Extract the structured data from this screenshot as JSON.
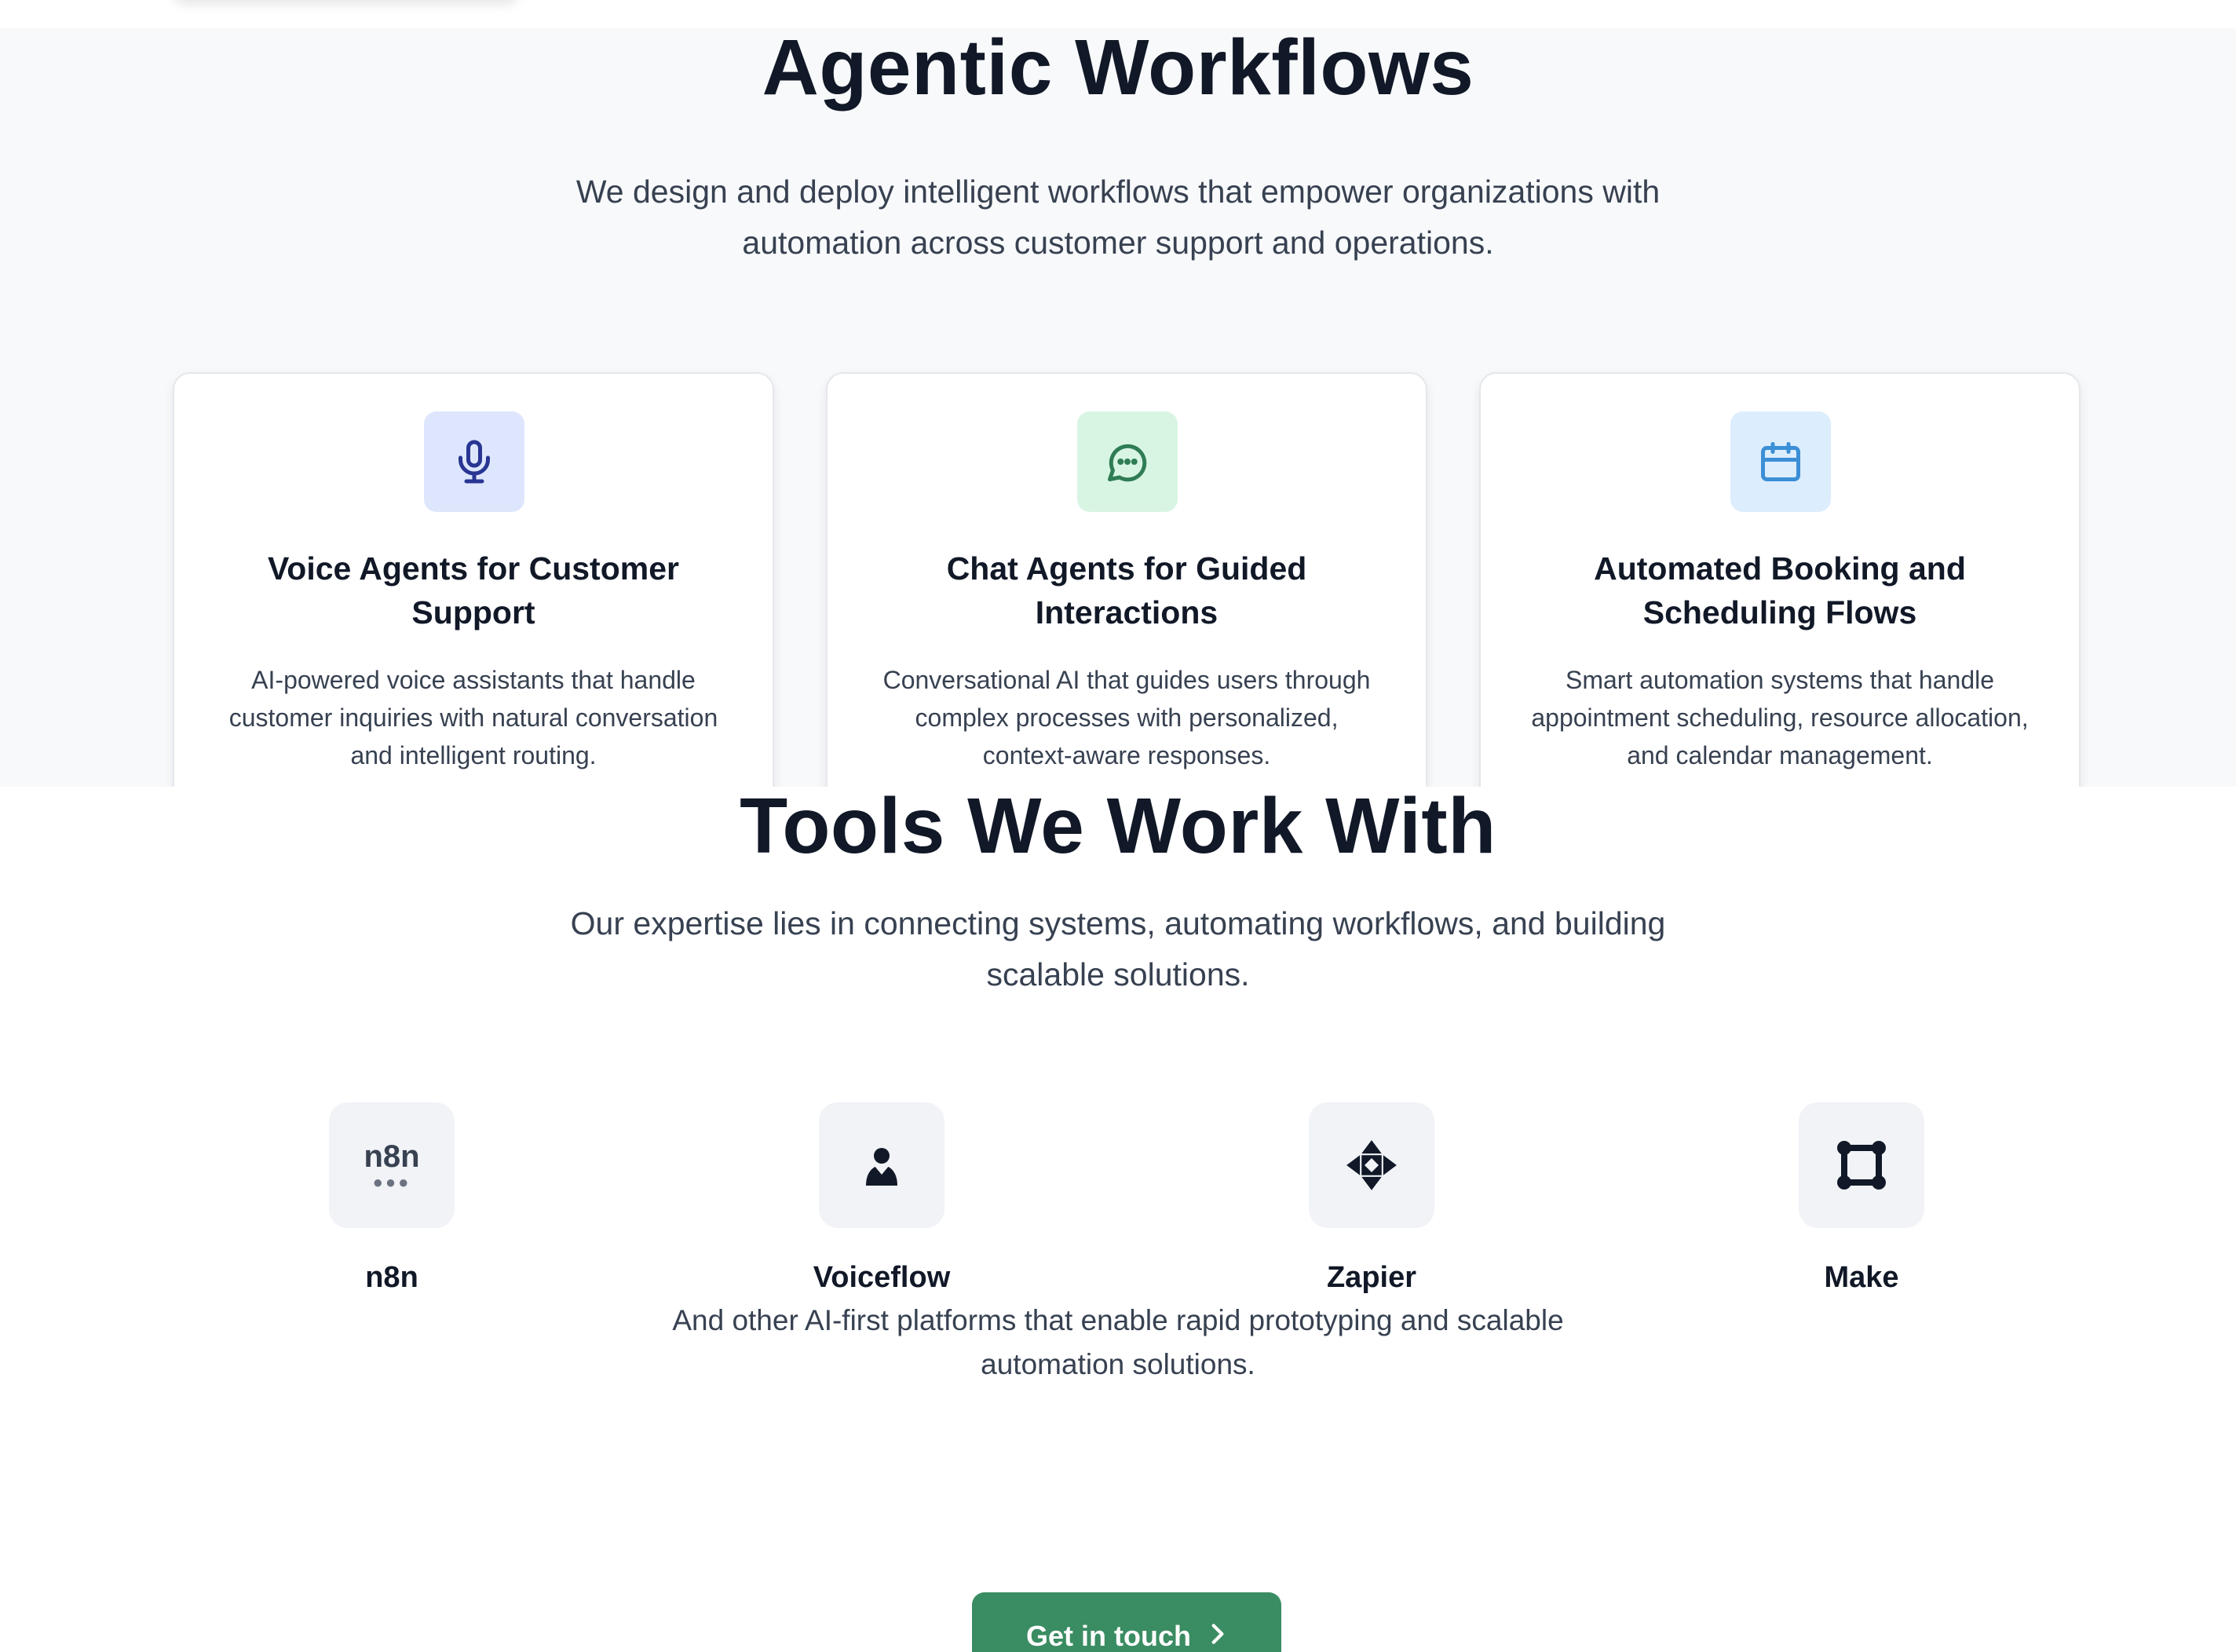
{
  "agentic": {
    "title": "Agentic Workflows",
    "subtitle": "We design and deploy intelligent workflows that empower organizations with automation across customer support and operations.",
    "cards": [
      {
        "icon": "microphone-icon",
        "icon_bg": "#dde6fd",
        "icon_color": "#283593",
        "title": "Voice Agents for Customer Support",
        "description": "AI-powered voice assistants that handle customer inquiries with natural conversation and intelligent routing."
      },
      {
        "icon": "chat-bubble-icon",
        "icon_bg": "#d8f5e3",
        "icon_color": "#2f7d55",
        "title": "Chat Agents for Guided Interactions",
        "description": "Conversational AI that guides users through complex processes with personalized, context-aware responses."
      },
      {
        "icon": "calendar-icon",
        "icon_bg": "#dcedfd",
        "icon_color": "#3b8fd6",
        "title": "Automated Booking and Scheduling Flows",
        "description": "Smart automation systems that handle appointment scheduling, resource allocation, and calendar management."
      }
    ]
  },
  "tools": {
    "title": "Tools We Work With",
    "subtitle": "Our expertise lies in connecting systems, automating workflows, and building scalable solutions.",
    "items": [
      {
        "name": "n8n",
        "icon": "n8n-logo-icon",
        "logo_text": "n8n",
        "logo_dots": "●●●"
      },
      {
        "name": "Voiceflow",
        "icon": "voiceflow-logo-icon"
      },
      {
        "name": "Zapier",
        "icon": "zapier-logo-icon"
      },
      {
        "name": "Make",
        "icon": "make-logo-icon"
      }
    ],
    "note": "And other AI-first platforms that enable rapid prototyping and scalable automation solutions."
  },
  "cta": {
    "label": "Get in touch",
    "icon": "chevron-right-icon",
    "color": "#3a8c62"
  }
}
